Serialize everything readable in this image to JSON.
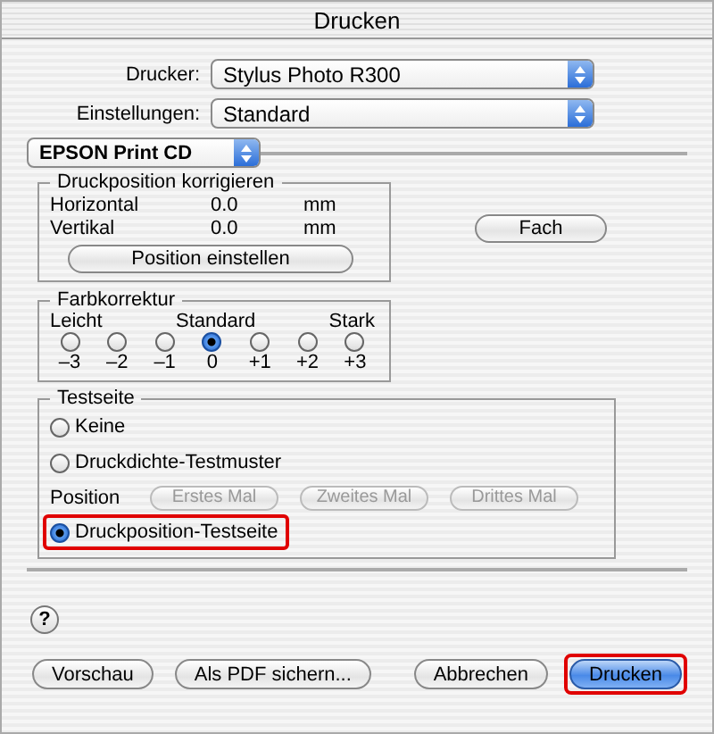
{
  "window": {
    "title": "Drucken"
  },
  "printer": {
    "label": "Drucker:",
    "value": "Stylus Photo R300"
  },
  "presets": {
    "label": "Einstellungen:",
    "value": "Standard"
  },
  "panel_menu": {
    "value": "EPSON Print CD"
  },
  "print_position": {
    "title": "Druckposition korrigieren",
    "rows": [
      {
        "label": "Horizontal",
        "value": "0.0",
        "unit": "mm"
      },
      {
        "label": "Vertikal",
        "value": "0.0",
        "unit": "mm"
      }
    ],
    "button": "Position einstellen"
  },
  "tray_button": "Fach",
  "color_correction": {
    "title": "Farbkorrektur",
    "scale_labels": [
      "Leicht",
      "Standard",
      "Stark"
    ],
    "options": [
      {
        "label": "–3",
        "selected": false
      },
      {
        "label": "–2",
        "selected": false
      },
      {
        "label": "–1",
        "selected": false
      },
      {
        "label": "0",
        "selected": true
      },
      {
        "label": "+1",
        "selected": false
      },
      {
        "label": "+2",
        "selected": false
      },
      {
        "label": "+3",
        "selected": false
      }
    ]
  },
  "test_page": {
    "title": "Testseite",
    "items": [
      {
        "kind": "radio",
        "label": "Keine",
        "selected": false,
        "highlighted": false
      },
      {
        "kind": "radio",
        "label": "Druckdichte-Testmuster",
        "selected": false,
        "highlighted": false
      },
      {
        "kind": "position",
        "label": "Position",
        "buttons": [
          {
            "label": "Erstes Mal",
            "disabled": true
          },
          {
            "label": "Zweites Mal",
            "disabled": true
          },
          {
            "label": "Drittes Mal",
            "disabled": true
          }
        ]
      },
      {
        "kind": "radio",
        "label": "Druckposition-Testseite",
        "selected": true,
        "highlighted": true
      }
    ]
  },
  "help_button": "?",
  "buttons": [
    {
      "label": "Vorschau",
      "default": false,
      "highlighted": false
    },
    {
      "label": "Als PDF sichern...",
      "default": false,
      "highlighted": false
    },
    {
      "label": "Abbrechen",
      "default": false,
      "highlighted": false
    },
    {
      "label": "Drucken",
      "default": true,
      "highlighted": true
    }
  ]
}
